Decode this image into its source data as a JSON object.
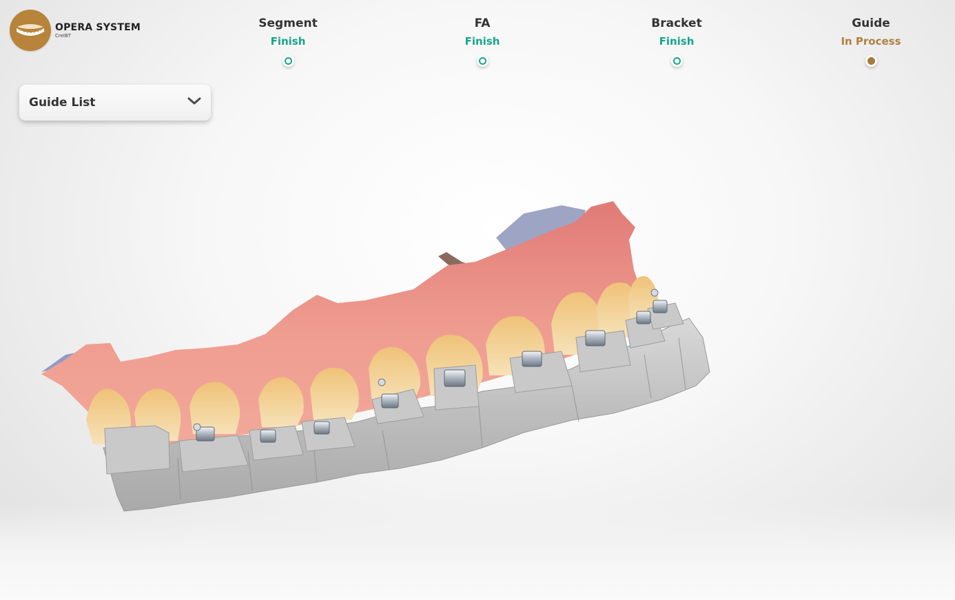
{
  "app": {
    "title": "OPERA SYSTEM",
    "subtitle": "CreIBT"
  },
  "steps": [
    {
      "name": "Segment",
      "status": "Finish",
      "state": "finish"
    },
    {
      "name": "FA",
      "status": "Finish",
      "state": "finish"
    },
    {
      "name": "Bracket",
      "status": "Finish",
      "state": "finish"
    },
    {
      "name": "Guide",
      "status": "In Process",
      "state": "in-process"
    }
  ],
  "guide_list": {
    "label": "Guide List",
    "icon": "chevron-down-icon"
  },
  "viewport": {
    "model": "dental-arch-with-brackets-and-guide"
  },
  "colors": {
    "finish": "#17a58c",
    "in_process": "#b08040",
    "logo": "#b8833a"
  }
}
